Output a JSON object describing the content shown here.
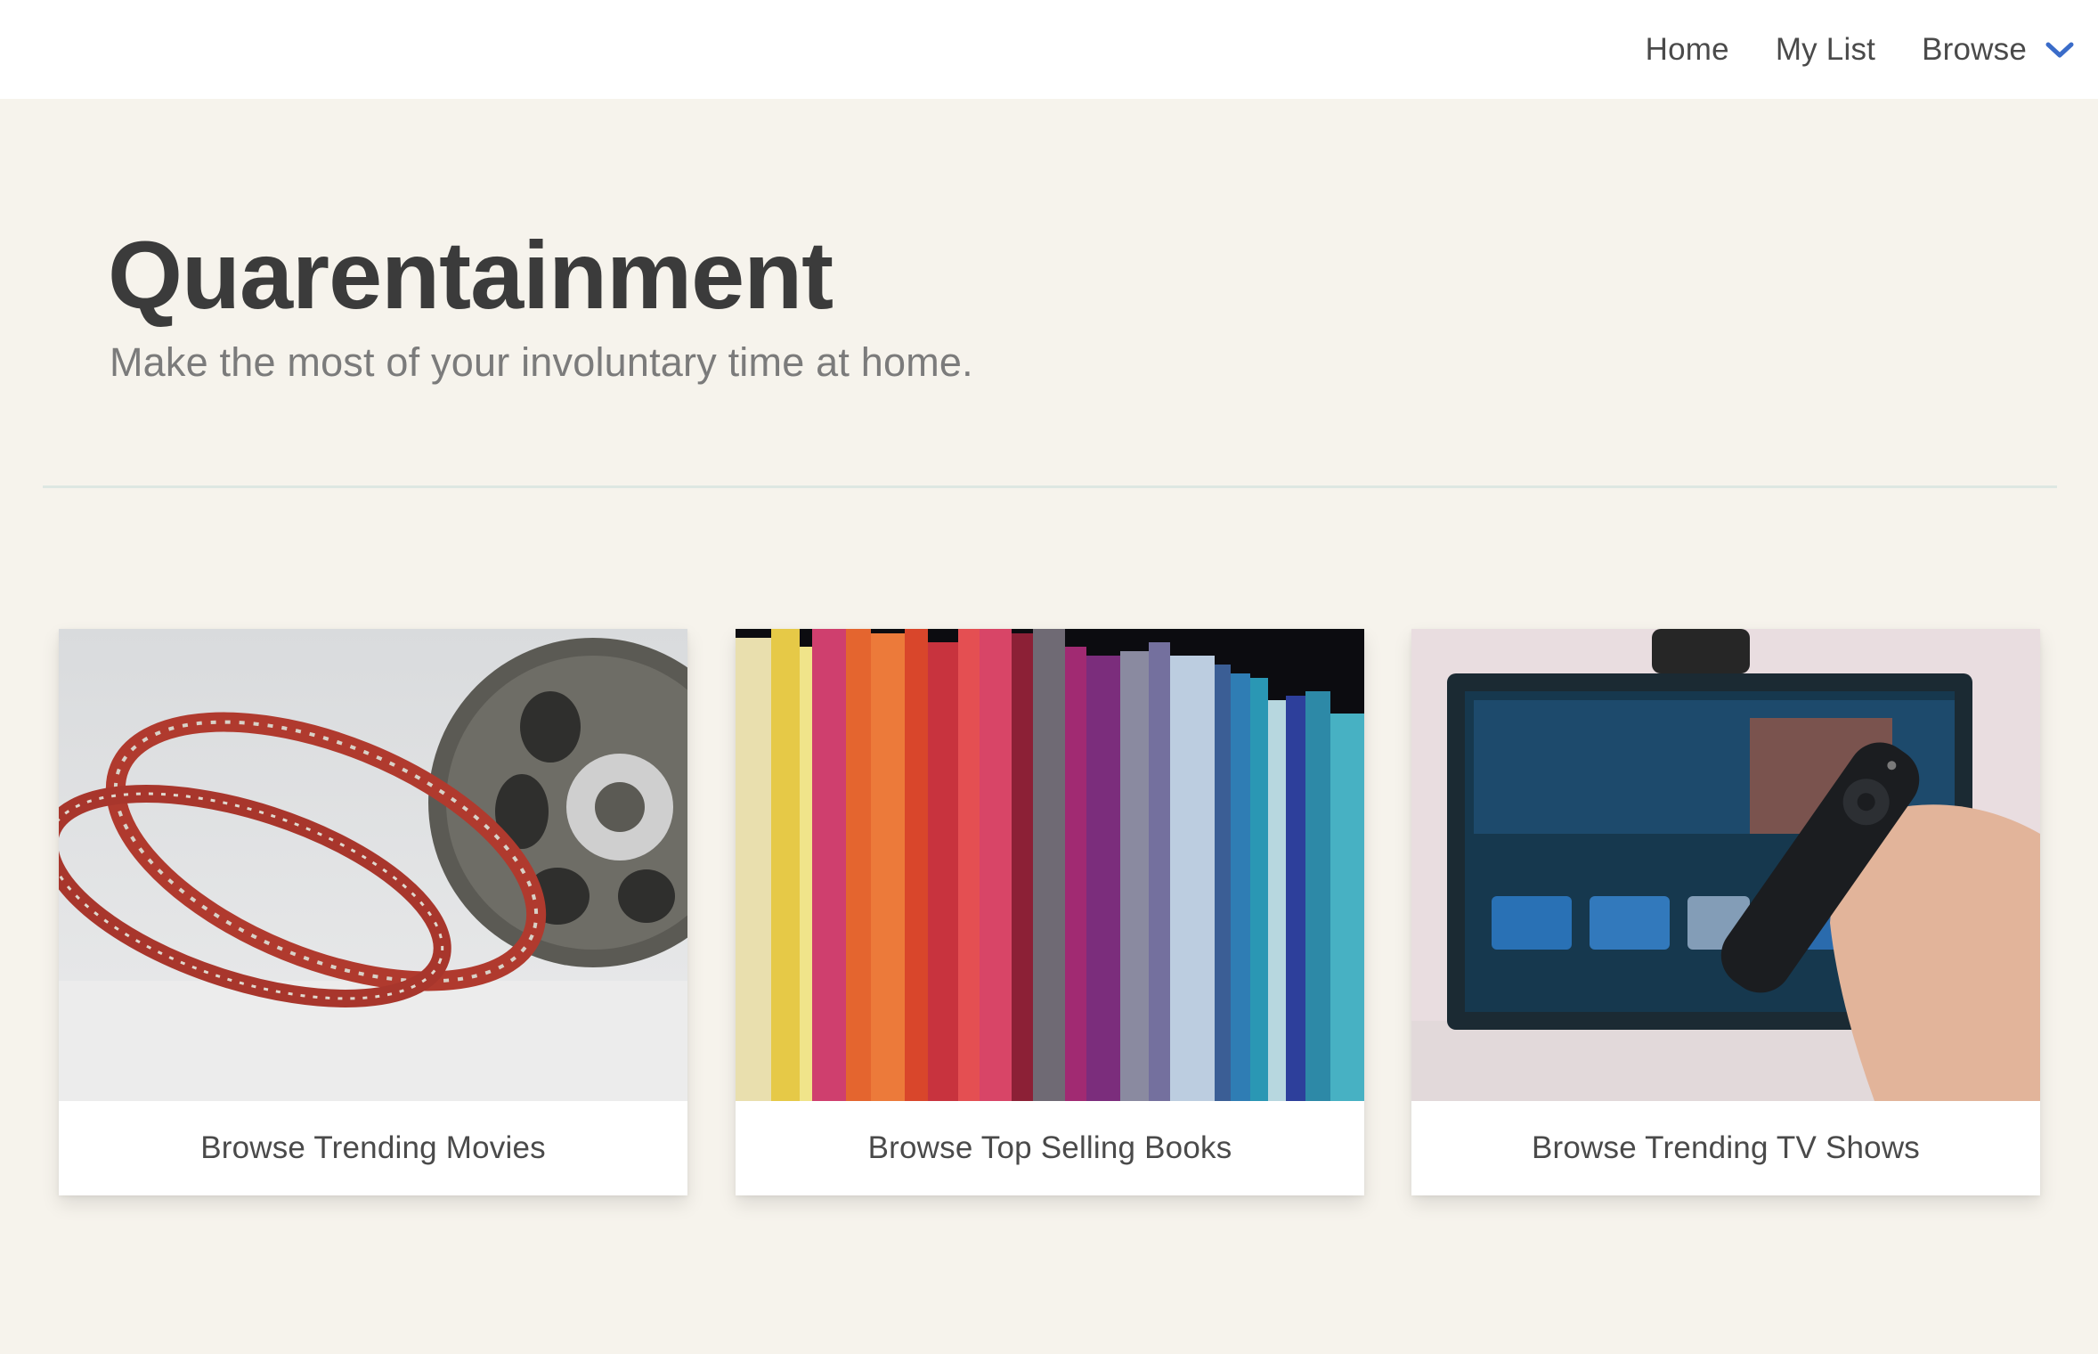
{
  "nav": {
    "home_label": "Home",
    "mylist_label": "My List",
    "browse_label": "Browse",
    "browse_icon": "chevron-down-icon",
    "accent_color": "#3a6cc9"
  },
  "hero": {
    "title": "Quarentainment",
    "subtitle": "Make the most of your involuntary time at home."
  },
  "cards": [
    {
      "label": "Browse Trending Movies",
      "image": "film-reel-photo"
    },
    {
      "label": "Browse Top Selling Books",
      "image": "bookshelf-photo"
    },
    {
      "label": "Browse Trending TV Shows",
      "image": "tv-remote-photo"
    }
  ]
}
